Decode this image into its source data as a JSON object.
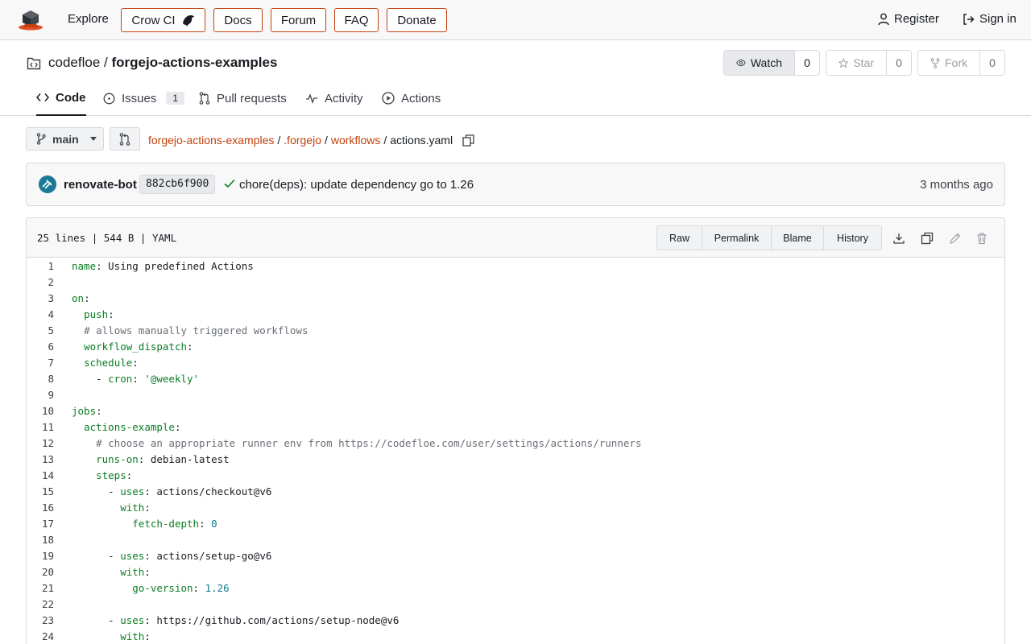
{
  "nav": {
    "explore": "Explore",
    "links": [
      "Crow CI",
      "Docs",
      "Forum",
      "FAQ",
      "Donate"
    ],
    "register": "Register",
    "sign_in": "Sign in"
  },
  "repo": {
    "owner": "codefloe",
    "separator": "/",
    "name": "forgejo-actions-examples",
    "watch_label": "Watch",
    "watch_count": "0",
    "star_label": "Star",
    "star_count": "0",
    "fork_label": "Fork",
    "fork_count": "0"
  },
  "tabs": {
    "code": "Code",
    "issues": "Issues",
    "issues_count": "1",
    "pulls": "Pull requests",
    "activity": "Activity",
    "actions": "Actions"
  },
  "path": {
    "branch": "main",
    "crumbs": [
      "forgejo-actions-examples",
      ".forgejo",
      "workflows"
    ],
    "file": "actions.yaml"
  },
  "commit": {
    "author": "renovate-bot",
    "sha": "882cb6f900",
    "message": "chore(deps): update dependency go to 1.26",
    "time": "3 months ago"
  },
  "file": {
    "info": "25 lines | 544 B | YAML",
    "buttons": [
      "Raw",
      "Permalink",
      "Blame",
      "History"
    ]
  },
  "code_lines": [
    "name: Using predefined Actions",
    "",
    "on:",
    "  push:",
    "  # allows manually triggered workflows",
    "  workflow_dispatch:",
    "  schedule:",
    "    - cron: '@weekly'",
    "",
    "jobs:",
    "  actions-example:",
    "    # choose an appropriate runner env from https://codefloe.com/user/settings/actions/runners",
    "    runs-on: debian-latest",
    "    steps:",
    "      - uses: actions/checkout@v6",
    "        with:",
    "          fetch-depth: 0",
    "",
    "      - uses: actions/setup-go@v6",
    "        with:",
    "          go-version: 1.26",
    "",
    "      - uses: https://github.com/actions/setup-node@v6",
    "        with:"
  ],
  "colors": {
    "accent": "#c2410c",
    "key": "#0a7d23",
    "comment": "#6a6e75",
    "number": "#0a7b8c",
    "border": "#d8d9dc"
  }
}
